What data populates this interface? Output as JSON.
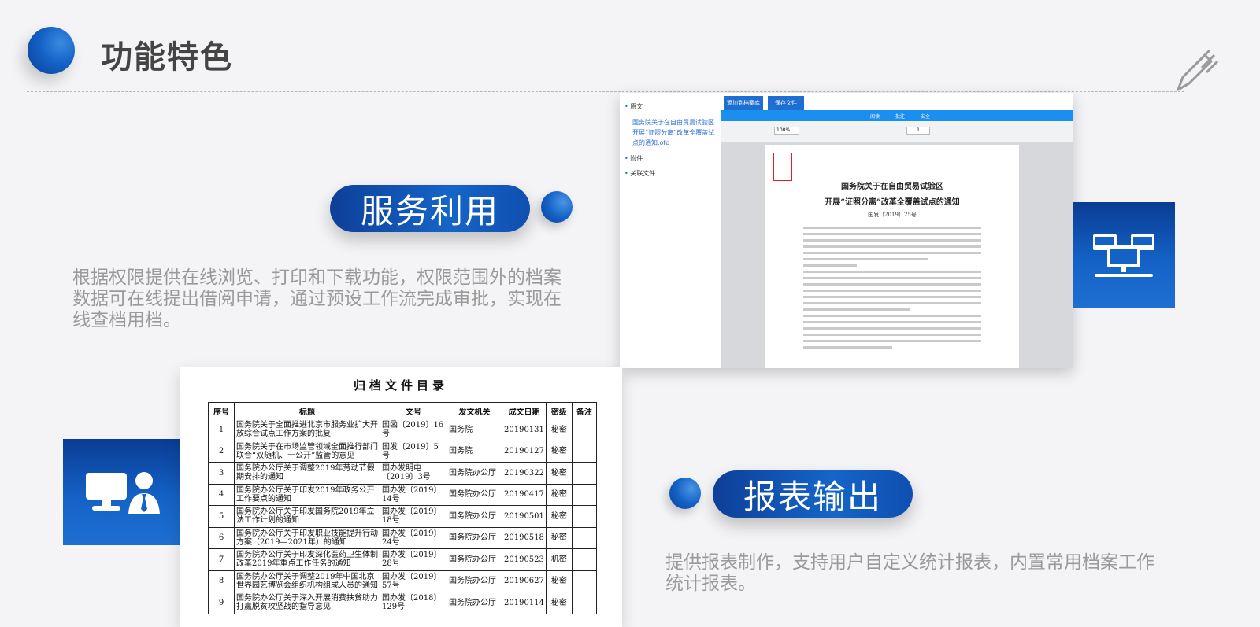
{
  "header": {
    "title": "功能特色"
  },
  "section_service": {
    "label": "服务利用",
    "description": "根据权限提供在线浏览、打印和下载功能，权限范围外的档案数据可在线提出借阅申请，通过预设工作流完成审批，实现在线查档用档。"
  },
  "section_report": {
    "label": "报表输出",
    "description": "提供报表制作，支持用户自定义统计报表，内置常用档案工作统计报表。"
  },
  "icons": {
    "pen": "pen-icon",
    "network": "network-icon",
    "user_pc": "user-computer-icon"
  },
  "colors": {
    "primary": "#1462c6",
    "dark": "#0a3f9a",
    "text_gray": "#9a9a9a",
    "title": "#444444"
  },
  "viewer": {
    "sidebar": {
      "original": "原文",
      "doc_link": "国务院关于在自由贸易试验区开展“证照分离”改革全覆盖试点的通知.ofd",
      "attachment": "附件",
      "related": "关联文件"
    },
    "tabs": [
      "添加到档案库",
      "保存文件"
    ],
    "toolbar_tabs": [
      "阅读",
      "批注",
      "安全"
    ],
    "zoom": "100%",
    "page_number": "1",
    "document": {
      "title_line1": "国务院关于在自由贸易试验区",
      "title_line2": "开展“证照分离”改革全覆盖试点的通知",
      "doc_no": "国发〔2019〕25号"
    }
  },
  "catalog": {
    "title": "归档文件目录",
    "columns": [
      "序号",
      "标题",
      "文号",
      "发文机关",
      "成文日期",
      "密级",
      "备注"
    ],
    "rows": [
      [
        "1",
        "国务院关于全面推进北京市服务业扩大开放综合试点工作方案的批复",
        "国函〔2019〕16号",
        "国务院",
        "20190131",
        "秘密",
        ""
      ],
      [
        "2",
        "国务院关于在市场监管领域全面推行部门联合“双随机、一公开”监管的意见",
        "国发〔2019〕5号",
        "国务院",
        "20190127",
        "秘密",
        ""
      ],
      [
        "3",
        "国务院办公厅关于调整2019年劳动节假期安排的通知",
        "国办发明电〔2019〕3号",
        "国务院办公厅",
        "20190322",
        "秘密",
        ""
      ],
      [
        "4",
        "国务院办公厅关于印发2019年政务公开工作要点的通知",
        "国办发〔2019〕14号",
        "国务院办公厅",
        "20190417",
        "秘密",
        ""
      ],
      [
        "5",
        "国务院办公厅关于印发国务院2019年立法工作计划的通知",
        "国办发〔2019〕18号",
        "国务院办公厅",
        "20190501",
        "秘密",
        ""
      ],
      [
        "6",
        "国务院办公厅关于印发职业技能提升行动方案（2019—2021年）的通知",
        "国办发〔2019〕24号",
        "国务院办公厅",
        "20190518",
        "秘密",
        ""
      ],
      [
        "7",
        "国务院办公厅关于印发深化医药卫生体制改革2019年重点工作任务的通知",
        "国办发〔2019〕28号",
        "国务院办公厅",
        "20190523",
        "机密",
        ""
      ],
      [
        "8",
        "国务院办公厅关于调整2019年中国北京世界园艺博览会组织机构组成人员的通知",
        "国办发〔2019〕57号",
        "国务院办公厅",
        "20190627",
        "秘密",
        ""
      ],
      [
        "9",
        "国务院办公厅关于深入开展消费扶贫助力打赢脱贫攻坚战的指导意见",
        "国办发〔2018〕129号",
        "国务院办公厅",
        "20190114",
        "秘密",
        ""
      ]
    ]
  }
}
